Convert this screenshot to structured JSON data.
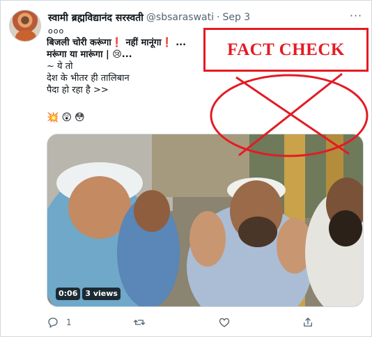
{
  "tweet": {
    "author_name": "स्वामी ब्रह्मविद्यानंद सरस्वती",
    "handle": "@sbsaraswati",
    "separator": "·",
    "date": "Sep 3",
    "more_icon": "more-horizontal-icon",
    "extra_line": "ooo",
    "lines": [
      {
        "text": "बिजली चोरी करूंगा❗  नहीं मानूंगा❗ ...",
        "bold": true
      },
      {
        "text": "मरूंगा या मारूंगा | 😢...",
        "bold": true
      },
      {
        "text": "~ ये तो",
        "bold": false
      },
      {
        "text": "देश के भीतर ही तालिबान",
        "bold": false
      },
      {
        "text": "पैदा हो रहा है >>",
        "bold": false
      }
    ],
    "emojis": [
      "💥",
      "😲",
      "😳"
    ],
    "media": {
      "duration": "0:06",
      "views": "3 views"
    },
    "actions": {
      "reply_icon": "reply-icon",
      "reply_count": "1",
      "retweet_icon": "retweet-icon",
      "like_icon": "heart-icon",
      "share_icon": "share-icon"
    }
  },
  "overlay": {
    "label": "FACT CHECK",
    "color": "#e31b23"
  }
}
